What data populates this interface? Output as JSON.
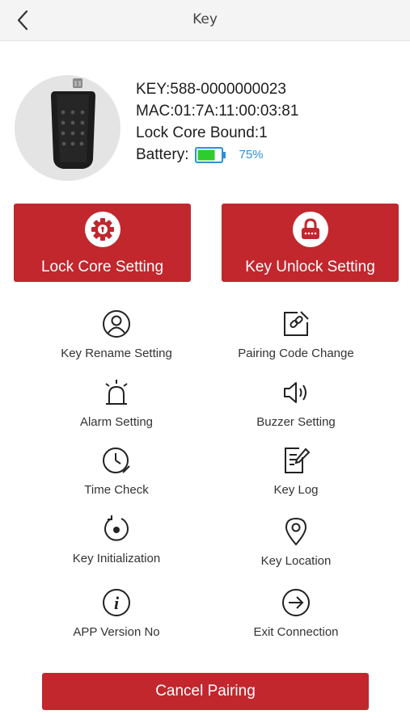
{
  "header": {
    "title": "Key",
    "back_icon": "chevron-left-icon"
  },
  "device": {
    "key_line": "KEY:588-0000000023",
    "mac_line": "MAC:01:7A:11:00:03:81",
    "lock_core_line": "Lock Core Bound:1",
    "battery_label": "Battery:",
    "battery_percent_text": "75%",
    "battery_level": 0.75,
    "battery_color": "#2ecc2e"
  },
  "main_actions": [
    {
      "label": "Lock Core Setting",
      "icon": "gear-lock-icon"
    },
    {
      "label": "Key Unlock Setting",
      "icon": "padlock-icon"
    }
  ],
  "settings": [
    {
      "label": "Key Rename Setting",
      "icon": "user-circle-icon"
    },
    {
      "label": "Pairing Code Change",
      "icon": "edit-link-icon"
    },
    {
      "label": "Alarm Setting",
      "icon": "alarm-siren-icon"
    },
    {
      "label": "Buzzer Setting",
      "icon": "speaker-icon"
    },
    {
      "label": "Time Check",
      "icon": "clock-icon"
    },
    {
      "label": "Key Log",
      "icon": "log-document-icon"
    },
    {
      "label": "Key Initialization",
      "icon": "reset-icon"
    },
    {
      "label": "Key Location",
      "icon": "location-pin-icon"
    },
    {
      "label": "APP Version No",
      "icon": "info-icon"
    },
    {
      "label": "Exit Connection",
      "icon": "exit-icon"
    }
  ],
  "footer": {
    "cancel_label": "Cancel Pairing"
  },
  "colors": {
    "accent": "#c1272d",
    "battery_text": "#2e8fd6"
  }
}
